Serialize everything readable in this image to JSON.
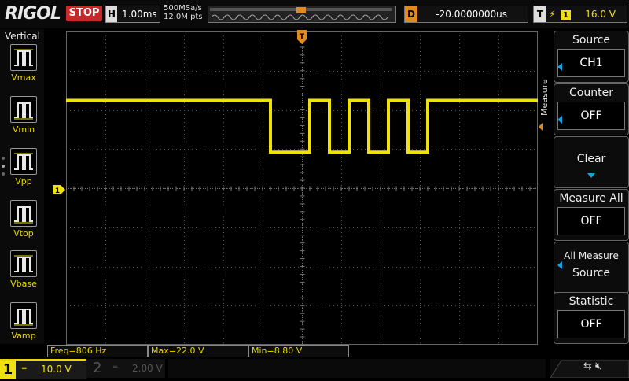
{
  "header": {
    "brand": "RIGOL",
    "run_state": "STOP",
    "timebase_key": "H",
    "timebase": "1.00ms",
    "sample_rate": "500MSa/s",
    "memory_depth": "12.0M pts",
    "delay_key": "D",
    "delay": "-20.0000000us",
    "trigger_key": "T",
    "trigger_source": "1",
    "trigger_level": "16.0 V",
    "trigger_marker": "T"
  },
  "left_menu": {
    "title": "Vertical",
    "items": [
      {
        "label": "Vmax",
        "icon": "vmax-icon"
      },
      {
        "label": "Vmin",
        "icon": "vmin-icon"
      },
      {
        "label": "Vpp",
        "icon": "vpp-icon"
      },
      {
        "label": "Vtop",
        "icon": "vtop-icon"
      },
      {
        "label": "Vbase",
        "icon": "vbase-icon"
      },
      {
        "label": "Vamp",
        "icon": "vamp-icon"
      }
    ]
  },
  "right_menu": {
    "section_label": "Measure",
    "source": {
      "title": "Source",
      "value": "CH1"
    },
    "counter": {
      "title": "Counter",
      "value": "OFF"
    },
    "clear": {
      "title": "Clear"
    },
    "measure_all": {
      "title": "Measure All",
      "value": "OFF"
    },
    "all_measure_source": {
      "line1": "All Measure",
      "line2": "Source"
    },
    "statistic": {
      "title": "Statistic",
      "value": "OFF"
    }
  },
  "measurements": {
    "freq": "Freq=806 Hz",
    "max": "Max=22.0 V",
    "min": "Min=8.80 V"
  },
  "channels": {
    "ch1": {
      "number": "1",
      "scale": "10.0 V",
      "marker": "1"
    },
    "ch2": {
      "number": "2",
      "scale": "2.00 V"
    }
  },
  "colors": {
    "ch1": "#f0e010",
    "trigger": "#e08a20",
    "stop": "#c8282a",
    "menu_indicator": "#19a0e0"
  },
  "waveform": {
    "time_per_div_ms": 1.0,
    "volts_per_div": 10.0,
    "high_level_v": 22.0,
    "low_level_v": 8.8,
    "pulses_low_ms": [
      [
        0.0,
        1.0
      ],
      [
        1.5,
        2.0
      ],
      [
        2.5,
        3.0
      ],
      [
        3.5,
        4.0
      ]
    ]
  }
}
